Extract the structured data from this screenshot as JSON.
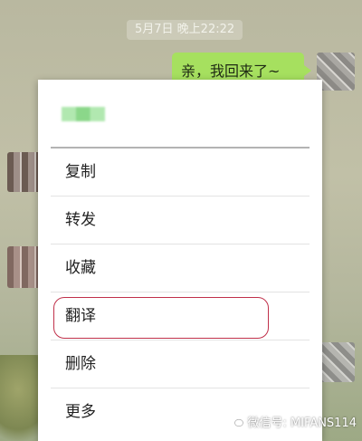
{
  "chat": {
    "timestamp": "5月7日 晚上22:22",
    "my_message": "亲，我回来了~"
  },
  "context_menu": {
    "contact_name_blurred": "",
    "items": [
      {
        "label": "复制"
      },
      {
        "label": "转发"
      },
      {
        "label": "收藏"
      },
      {
        "label": "翻译"
      },
      {
        "label": "删除"
      },
      {
        "label": "更多"
      }
    ],
    "highlighted_item": "翻译"
  },
  "watermark": {
    "text": "微信号: MIFANS114",
    "icon": "wechat-logo-icon"
  },
  "colors": {
    "bubble": "#a6e05f",
    "highlight_ring": "#c0304a"
  }
}
